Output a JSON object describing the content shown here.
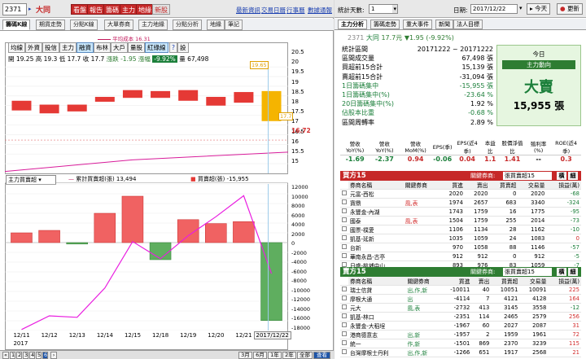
{
  "toolbar": {
    "stock_code": "2371",
    "stock_name": "大同",
    "red_buttons": [
      "看盤",
      "報告",
      "籌碼",
      "主力",
      "地緣",
      "新股"
    ],
    "links": [
      "最新資訊",
      "交易日曆",
      "行事曆",
      "數據通報"
    ]
  },
  "left_tabs": [
    "籌碼K線",
    "期貨走勢",
    "分點K線",
    "大單券商",
    "主力地緣",
    "分點分析",
    "地緣",
    "筆記"
  ],
  "chart_tools": [
    "均線",
    "外資",
    "投信",
    "主力",
    "融資",
    "布林",
    "大戶",
    "量股",
    "紅綠線",
    "?",
    "設"
  ],
  "price_info": {
    "high": "開 19.25",
    "open": "高 19.3",
    "low": "低 17.7",
    "close": "收 17.7",
    "change": "漲跌 -1.95",
    "pct_label": "漲幅",
    "pct": "-9.92%",
    "volume": "量 67,498"
  },
  "cost_label": "平均成本 16.31",
  "price_tags": {
    "high": "19.65",
    "low": "17.7",
    "last": "16.72"
  },
  "y_axis_top": [
    "20.5",
    "20",
    "19.5",
    "19",
    "18.5",
    "18",
    "17.5",
    "17",
    "16.5",
    "16",
    "15.5",
    "15"
  ],
  "sub_chart": {
    "selector": "主力買賣超",
    "legend_line": "累計買賣超(張) 13,494",
    "legend_bar": "買賣超(張) -15,955",
    "y_axis": [
      "12000",
      "10000",
      "8000",
      "6000",
      "4000",
      "2000",
      "0",
      "-2000",
      "-4000",
      "-6000",
      "-8000",
      "-10000",
      "-12000",
      "-14000",
      "-16000",
      "-18000"
    ]
  },
  "x_axis": {
    "dates": [
      "12/11",
      "12/12",
      "12/13",
      "12/14",
      "12/15",
      "12/18",
      "12/19",
      "12/20",
      "12/21"
    ],
    "year": "2017",
    "current": "2017/12/22"
  },
  "chart_data": {
    "type": "bar",
    "categories": [
      "12/11",
      "12/12",
      "12/13",
      "12/14",
      "12/15",
      "12/18",
      "12/19",
      "12/20",
      "12/21",
      "12/22"
    ],
    "series": [
      {
        "name": "買賣超(張)",
        "values": [
          2000,
          2500,
          -300,
          6000,
          9500,
          -3500,
          4700,
          3900,
          4300,
          -15955
        ]
      },
      {
        "name": "累計買賣超(張)",
        "values": [
          -17800,
          -15000,
          -15300,
          -9300,
          200,
          -3300,
          1400,
          5300,
          9600,
          -6355
        ]
      }
    ],
    "price_candles": [
      {
        "date": "12/11",
        "open": 18.25,
        "close": 18.75
      },
      {
        "date": "12/12",
        "open": 18.1,
        "close": 18.55
      },
      {
        "date": "12/13",
        "open": 18.2,
        "close": 18.55
      },
      {
        "date": "12/14",
        "open": 18.7,
        "close": 18.95
      },
      {
        "date": "12/15",
        "open": 18.9,
        "close": 19.3
      },
      {
        "date": "12/18",
        "open": 18.9,
        "close": 19.25
      },
      {
        "date": "12/19",
        "open": 18.75,
        "close": 19.3
      },
      {
        "date": "12/20",
        "open": 18.5,
        "close": 18.95
      },
      {
        "date": "12/21",
        "open": 18.65,
        "close": 19.2
      },
      {
        "date": "12/22",
        "open": 19.25,
        "close": 17.7
      }
    ],
    "ylim": [
      -18000,
      12000
    ]
  },
  "bottom": {
    "pages": [
      "1",
      "2",
      "3",
      "4",
      "5",
      "6"
    ],
    "ranges": [
      "3月",
      "6月",
      "1年",
      "2年",
      "全部",
      "查看"
    ]
  },
  "right_top": {
    "days_label": "統計天數:",
    "days_value": "1",
    "date_label": "日期:",
    "date_value": "2017/12/22",
    "today": "今天",
    "refresh": "更新"
  },
  "right_tabs": [
    "主力分析",
    "籌碼走勢",
    "重大事件",
    "新聞",
    "法人目標"
  ],
  "stock_line": {
    "code": "2371",
    "name": "大同",
    "price": "17.7元",
    "change": "▼1.95 (-9.92%)"
  },
  "stats": [
    {
      "label": "統計區間",
      "value": "20171222 ~ 20171222"
    },
    {
      "label": "區間成交量",
      "value": "67,498 張"
    },
    {
      "label": "買超前15合計",
      "value": "15,139 張"
    },
    {
      "label": "賣超前15合計",
      "value": "-31,094 張"
    },
    {
      "label": "1日籌碼集中",
      "value": "-15,955 張"
    },
    {
      "label": "1日籌碼集中(%)",
      "value": "-23.64 %"
    },
    {
      "label": "20日籌碼集中(%)",
      "value": "1.92 %"
    },
    {
      "label": "佔股本比重",
      "value": "-0.68 %"
    },
    {
      "label": "區間周轉率",
      "value": "2.89 %"
    }
  ],
  "today_box": {
    "line1": "今日",
    "line2": "主力動向",
    "verdict": "大賣",
    "amount": "15,955 張"
  },
  "pct_headers": [
    "營收YoY(%)",
    "營收YoY(%)",
    "營收MoM(%)",
    "EPS(季)",
    "EPS(近4季)",
    "本益比",
    "股價淨值比",
    "殖利率(%)",
    "ROE(近4季)"
  ],
  "pct_values": [
    "-1.69",
    "-2.37",
    "0.94",
    "-0.06",
    "0.04",
    "1.1",
    "1.41",
    "--",
    "0.3"
  ],
  "buy_section": {
    "title": "買方15",
    "select_label": "關鍵券商:",
    "select_value": "張買賣超15",
    "cols": [
      "券商名稱",
      "關鍵券商",
      "買進",
      "賣出",
      "買賣超",
      "交易量",
      "損益(萬)"
    ],
    "rows": [
      [
        "元富-西松",
        "",
        "2020",
        "2020",
        "0",
        "2020",
        "-68"
      ],
      [
        "寶鼎",
        "風,表",
        "1974",
        "2657",
        "683",
        "3340",
        "-324"
      ],
      [
        "永豐金-內湖",
        "",
        "1743",
        "1759",
        "16",
        "1775",
        "-95"
      ],
      [
        "國泰",
        "風,表",
        "1504",
        "1759",
        "255",
        "2014",
        "-73"
      ],
      [
        "國票-樸愛",
        "",
        "1106",
        "1134",
        "28",
        "1162",
        "-10"
      ],
      [
        "凱基-延新",
        "",
        "1035",
        "1059",
        "24",
        "1083",
        "0"
      ],
      [
        "台新",
        "",
        "970",
        "1058",
        "88",
        "1146",
        "-57"
      ],
      [
        "華南永昌-古亭",
        "",
        "912",
        "912",
        "0",
        "912",
        "-5"
      ],
      [
        "日盛-桃埔中山",
        "",
        "893",
        "976",
        "83",
        "1059",
        "-7"
      ]
    ]
  },
  "sell_section": {
    "title": "賣方15",
    "select_label": "關鍵券商:",
    "select_value": "張買賣超15",
    "cols": [
      "券商名稱",
      "關鍵券商",
      "買進",
      "賣出",
      "買賣超",
      "交易量",
      "損益(萬)"
    ],
    "rows": [
      [
        "瑞士信貸",
        "出,作,新",
        "-10011",
        "40",
        "10051",
        "10091",
        "225"
      ],
      [
        "摩根大通",
        "出",
        "-4114",
        "7",
        "4121",
        "4128",
        "164"
      ],
      [
        "元大",
        "風,表",
        "-2732",
        "413",
        "3145",
        "3558",
        "-12"
      ],
      [
        "凱基-林口",
        "",
        "-2351",
        "114",
        "2465",
        "2579",
        "256"
      ],
      [
        "永豐金-大稻埕",
        "",
        "-1967",
        "60",
        "2027",
        "2087",
        "31"
      ],
      [
        "港商德意志",
        "出,新",
        "-1957",
        "2",
        "1959",
        "1961",
        "72"
      ],
      [
        "統一",
        "作,新",
        "-1501",
        "869",
        "2370",
        "3239",
        "115"
      ],
      [
        "台灣摩根士丹利",
        "出,作,新",
        "-1266",
        "651",
        "1917",
        "2568",
        "21"
      ]
    ]
  },
  "icons": {
    "search": "search-icon",
    "refresh": "refresh-icon"
  }
}
